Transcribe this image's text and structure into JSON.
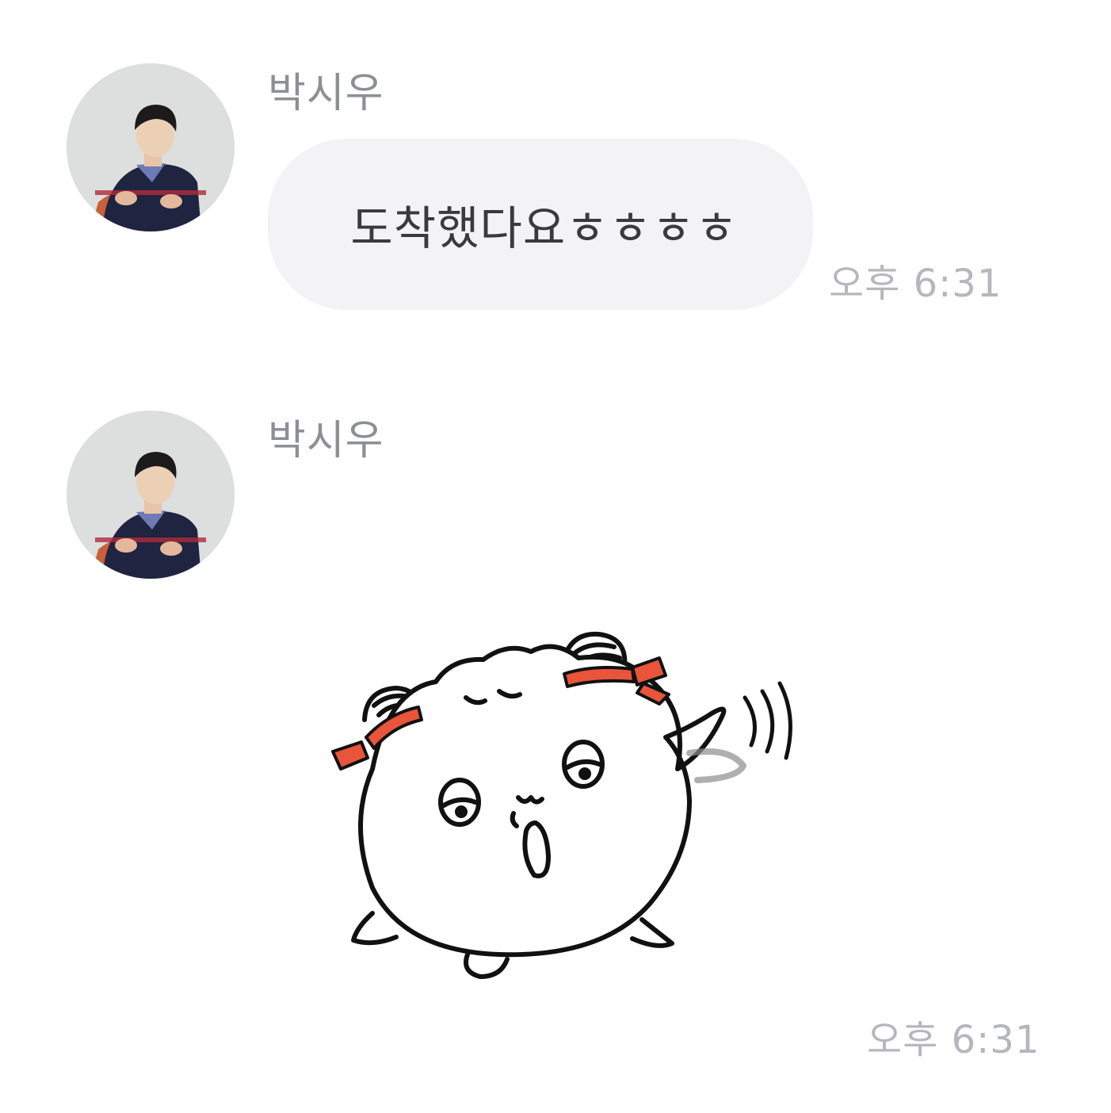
{
  "messages": [
    {
      "sender": "박시우",
      "type": "text",
      "text": "도착했다요ㅎㅎㅎㅎ",
      "time": "오후 6:31"
    },
    {
      "sender": "박시우",
      "type": "sticker",
      "sticker_icon": "white-mochi-character-waving-sticker",
      "time": "오후 6:31"
    }
  ],
  "colors": {
    "bubble": "#f3f3f5",
    "name_text": "#8d8f96",
    "time_text": "#b6b7be",
    "message_text": "#3a3a3e",
    "sticker_accent": "#e8553a"
  }
}
